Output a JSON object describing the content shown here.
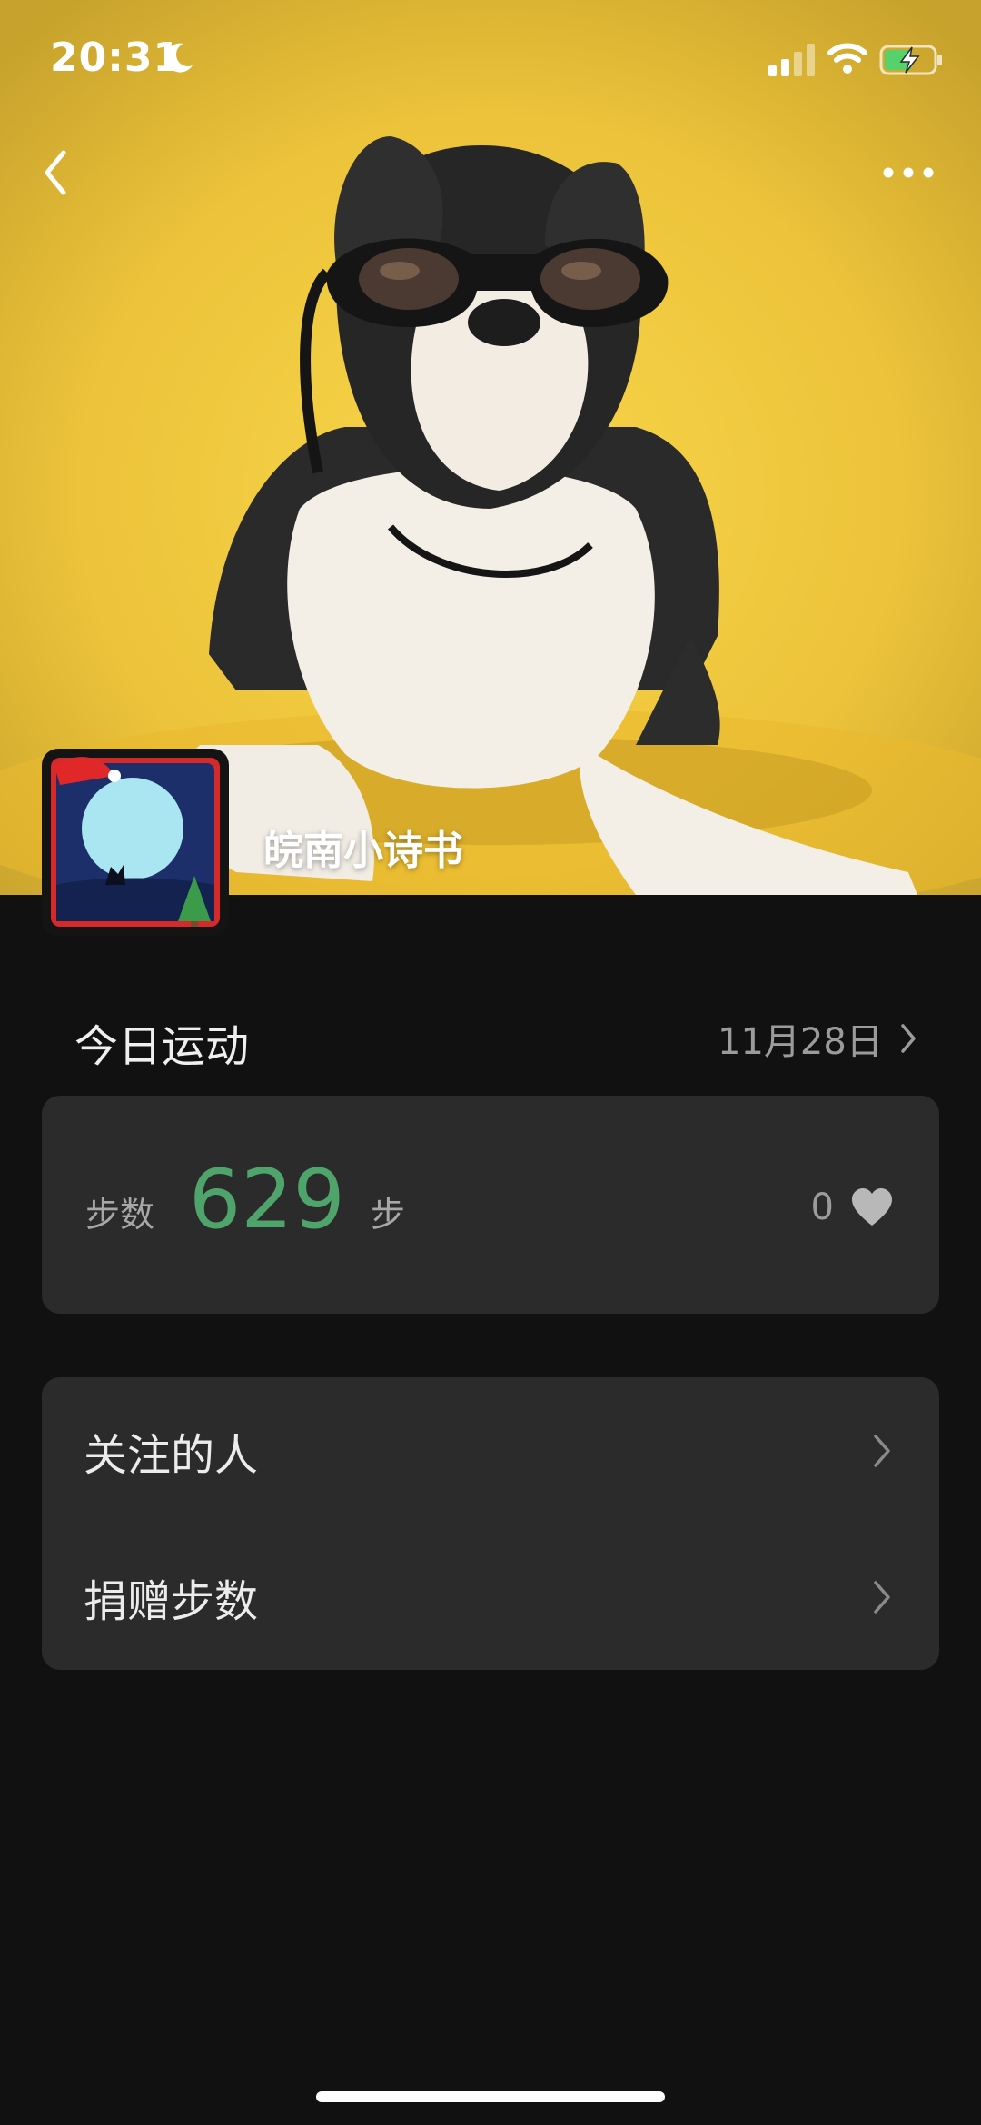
{
  "status_bar": {
    "time": "20:31"
  },
  "profile": {
    "username": "皖南小诗书"
  },
  "today": {
    "title": "今日运动",
    "date": "11月28日",
    "steps_label": "步数",
    "steps": "629",
    "steps_unit": "步",
    "likes": "0"
  },
  "menu": [
    {
      "label": "关注的人"
    },
    {
      "label": "捐赠步数"
    }
  ],
  "colors": {
    "accent_green": "#4fa46b",
    "card_bg": "#2b2b2b",
    "page_bg": "#111111",
    "cover_yellow": "#eec53a"
  },
  "icons": [
    "moon-icon",
    "cellular-signal-icon",
    "wifi-icon",
    "battery-charging-icon",
    "back-icon",
    "more-icon",
    "chevron-right-icon",
    "heart-icon"
  ]
}
